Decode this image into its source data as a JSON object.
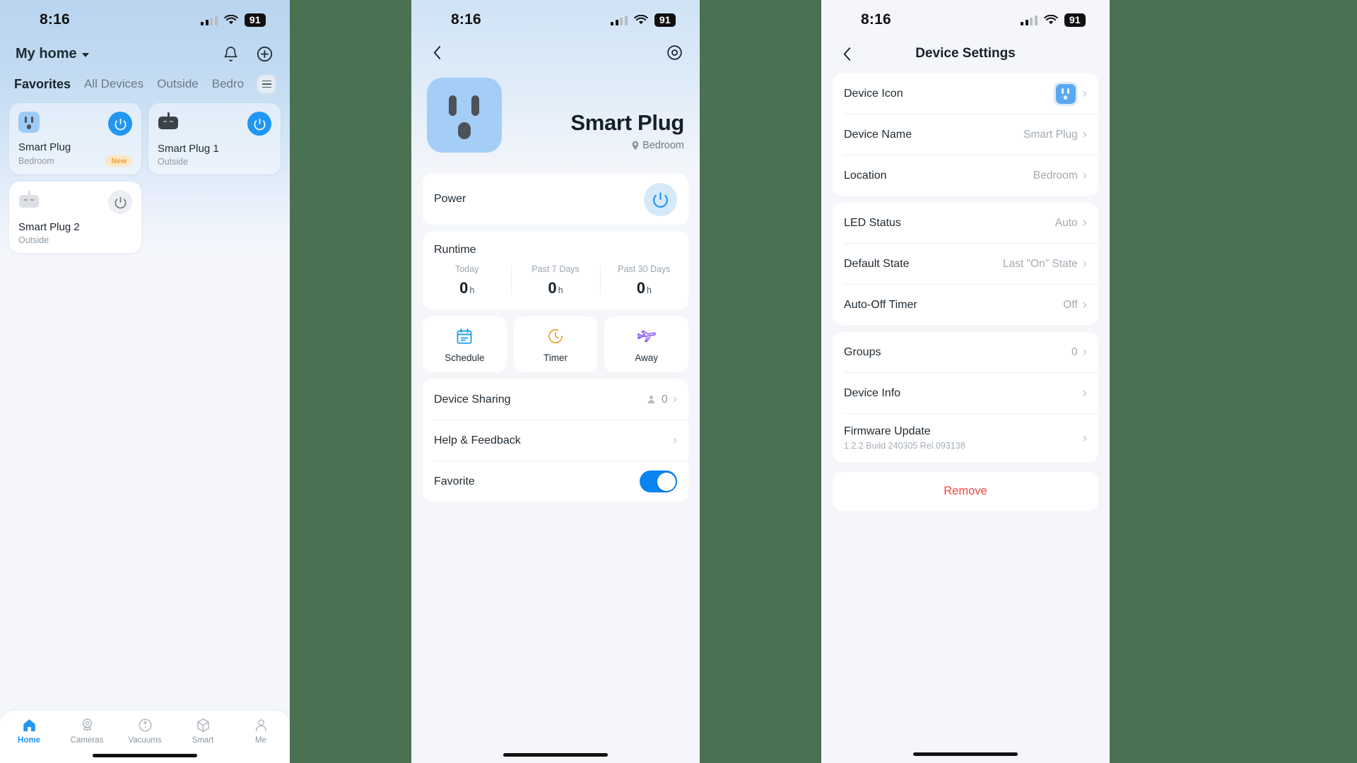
{
  "status_bar": {
    "time": "8:16",
    "battery": "91",
    "wifi_icon": "wifi-icon",
    "signal_icon": "cellular-signal-icon"
  },
  "colors": {
    "accent_blue": "#2196f3",
    "toggle_blue": "#0a84f0",
    "badge_orange": "#f0a028",
    "remove_red": "#f0443f",
    "schedule_blue": "#1b9df0",
    "timer_orange": "#f5a63c",
    "away_purple": "#8b5cf6"
  },
  "home": {
    "title": "My home",
    "dropdown_icon": "chevron-down-icon",
    "bell_icon": "bell-icon",
    "add_icon": "plus-circle-icon",
    "list_icon": "list-menu-icon",
    "tabs": [
      {
        "label": "Favorites",
        "active": true
      },
      {
        "label": "All Devices",
        "active": false
      },
      {
        "label": "Outside",
        "active": false
      },
      {
        "label": "Bedro",
        "active": false
      }
    ],
    "devices": [
      {
        "name": "Smart Plug",
        "room": "Bedroom",
        "power": "on",
        "badge": "New",
        "icon": "smart-plug-blue-icon",
        "card_state": "on"
      },
      {
        "name": "Smart Plug 1",
        "room": "Outside",
        "power": "on",
        "badge": "",
        "icon": "smart-plug-dark-icon",
        "card_state": "on"
      },
      {
        "name": "Smart Plug 2",
        "room": "Outside",
        "power": "off",
        "badge": "",
        "icon": "smart-plug-grey-icon",
        "card_state": "off"
      }
    ],
    "tabbar": [
      {
        "label": "Home",
        "icon": "home-icon",
        "active": true
      },
      {
        "label": "Cameras",
        "icon": "camera-icon",
        "active": false
      },
      {
        "label": "Vacuums",
        "icon": "vacuum-icon",
        "active": false
      },
      {
        "label": "Smart",
        "icon": "cube-icon",
        "active": false
      },
      {
        "label": "Me",
        "icon": "person-icon",
        "active": false
      }
    ]
  },
  "detail": {
    "back_icon": "chevron-left-icon",
    "settings_icon": "gear-icon",
    "device_name": "Smart Plug",
    "location": "Bedroom",
    "location_icon": "pin-icon",
    "device_icon": "smart-plug-blue-icon",
    "power": {
      "label": "Power",
      "state": "on",
      "icon": "power-icon"
    },
    "runtime": {
      "title": "Runtime",
      "stats": [
        {
          "key": "Today",
          "value": "0",
          "unit": "h"
        },
        {
          "key": "Past 7 Days",
          "value": "0",
          "unit": "h"
        },
        {
          "key": "Past 30 Days",
          "value": "0",
          "unit": "h"
        }
      ]
    },
    "actions": [
      {
        "label": "Schedule",
        "icon": "calendar-icon"
      },
      {
        "label": "Timer",
        "icon": "clock-timer-icon"
      },
      {
        "label": "Away",
        "icon": "airplane-icon"
      }
    ],
    "rows": [
      {
        "label": "Device Sharing",
        "value": "0",
        "icon": "person-small-icon",
        "chevron": true
      },
      {
        "label": "Help & Feedback",
        "value": "",
        "icon": "",
        "chevron": true
      }
    ],
    "favorite": {
      "label": "Favorite",
      "state": "on"
    }
  },
  "settings": {
    "back_icon": "chevron-left-icon",
    "title": "Device Settings",
    "group1": [
      {
        "label": "Device Icon",
        "value": "",
        "icon": "smart-plug-blue-icon",
        "chevron": true
      },
      {
        "label": "Device Name",
        "value": "Smart Plug",
        "icon": "",
        "chevron": true
      },
      {
        "label": "Location",
        "value": "Bedroom",
        "icon": "",
        "chevron": true
      }
    ],
    "group2": [
      {
        "label": "LED Status",
        "value": "Auto",
        "chevron": true
      },
      {
        "label": "Default State",
        "value": "Last \"On\" State",
        "chevron": true
      },
      {
        "label": "Auto-Off Timer",
        "value": "Off",
        "chevron": true
      }
    ],
    "group3": [
      {
        "label": "Groups",
        "value": "0",
        "sub": "",
        "chevron": true
      },
      {
        "label": "Device Info",
        "value": "",
        "sub": "",
        "chevron": true
      },
      {
        "label": "Firmware Update",
        "value": "",
        "sub": "1.2.2 Build 240305 Rel.093138",
        "chevron": true
      }
    ],
    "remove_label": "Remove"
  }
}
